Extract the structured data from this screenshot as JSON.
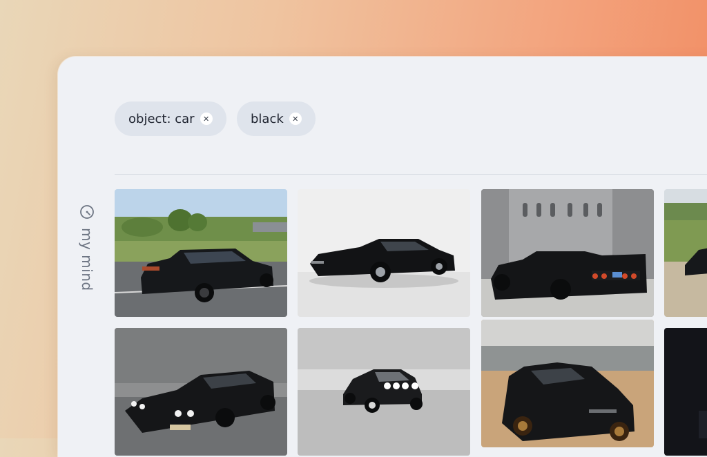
{
  "filters": [
    {
      "label": "object: car",
      "remove_icon": "close-icon"
    },
    {
      "label": "black",
      "remove_icon": "close-icon"
    }
  ],
  "sidebar": {
    "label": "my mind",
    "icon": "gauge-icon"
  },
  "results": [
    {
      "subject": "black bmw coupe parked on roadside"
    },
    {
      "subject": "black ferrari coupe studio shot"
    },
    {
      "subject": "black ferrari f40 rear view"
    },
    {
      "subject": "black car on sandy field (partial)"
    },
    {
      "subject": "black ferrari testarossa in fog"
    },
    {
      "subject": "black porsche 911 rally in desert"
    },
    {
      "subject": "black honda nsx in parking garage"
    },
    {
      "subject": "dark image (partial)"
    }
  ],
  "colors": {
    "chip_bg": "#dfe4ec",
    "window_bg": "#eff1f5",
    "label_text": "#6c7482"
  }
}
